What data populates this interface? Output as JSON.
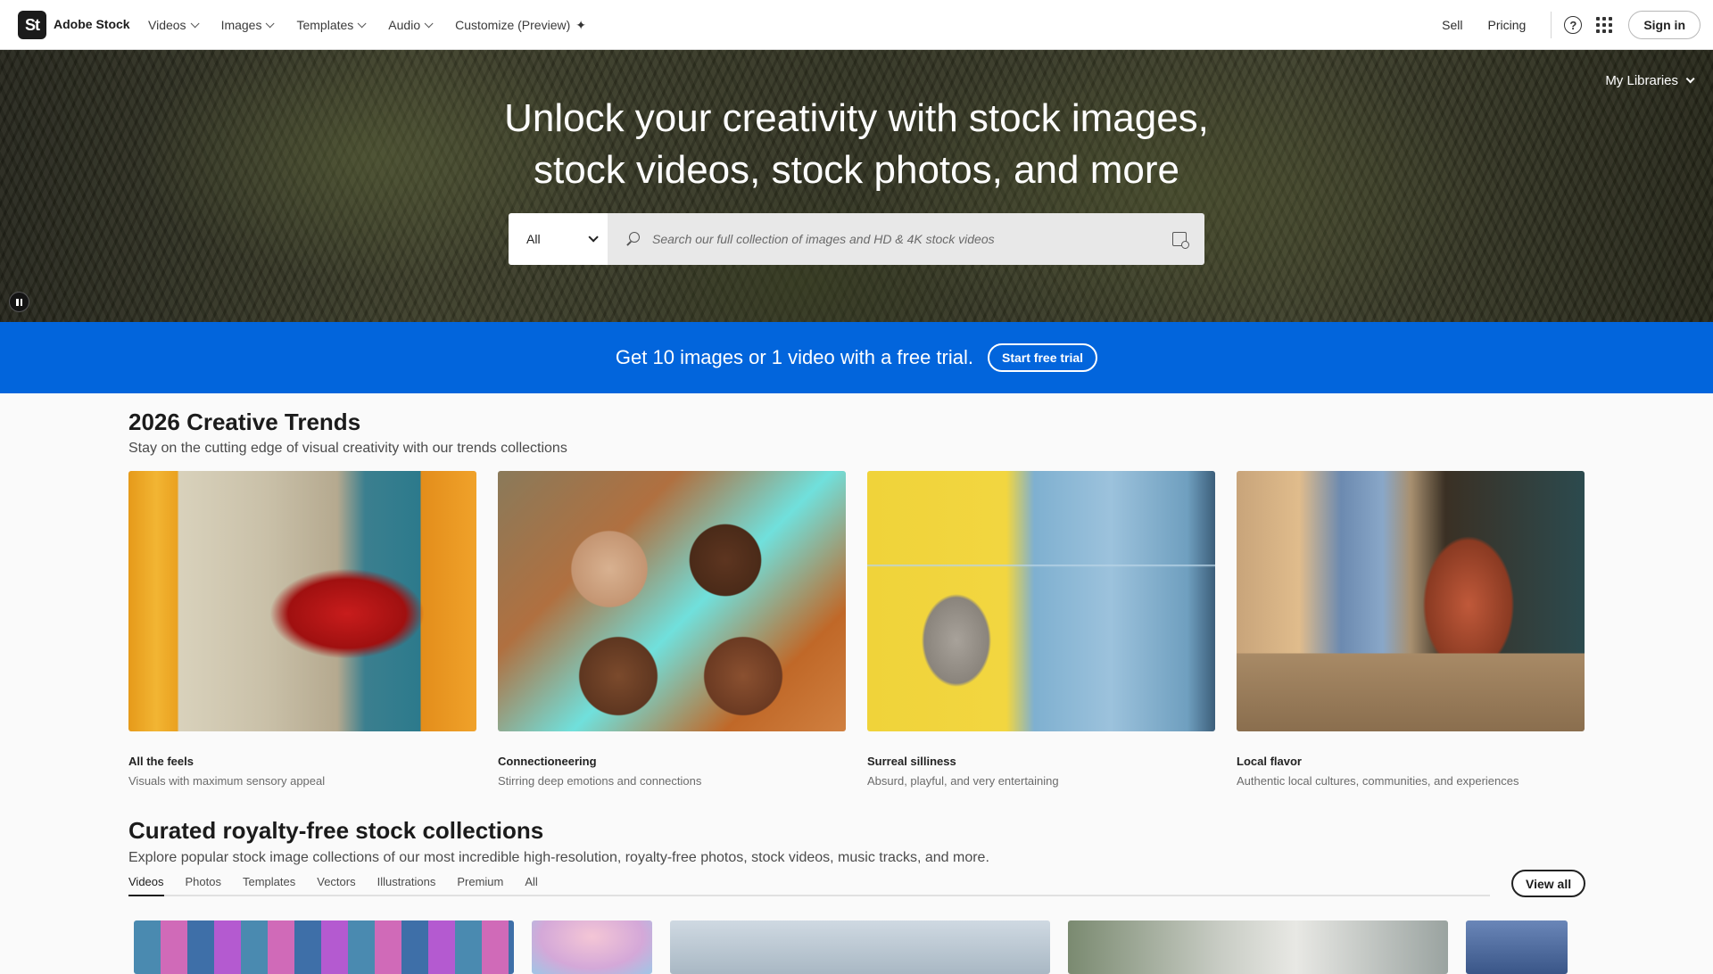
{
  "nav": {
    "logo": "St",
    "brand": "Adobe Stock",
    "menu": [
      {
        "label": "Videos"
      },
      {
        "label": "Images"
      },
      {
        "label": "Templates"
      },
      {
        "label": "Audio"
      },
      {
        "label": "Customize (Preview)"
      }
    ],
    "sell": "Sell",
    "pricing": "Pricing",
    "help": "?",
    "signin": "Sign in"
  },
  "hero": {
    "title_line1": "Unlock your creativity with stock images,",
    "title_line2": "stock videos, stock photos, and more",
    "libraries": "My Libraries",
    "search": {
      "category": "All",
      "placeholder": "Search our full collection of images and HD & 4K stock videos"
    }
  },
  "promo": {
    "text": "Get 10 images or 1 video with a free trial.",
    "button": "Start free trial"
  },
  "trends": {
    "title": "2026 Creative Trends",
    "subtitle": "Stay on the cutting edge of visual creativity with our trends collections",
    "items": [
      {
        "title": "All the feels",
        "desc": "Visuals with maximum sensory appeal"
      },
      {
        "title": "Connectioneering",
        "desc": "Stirring deep emotions and connections"
      },
      {
        "title": "Surreal silliness",
        "desc": "Absurd, playful, and very entertaining"
      },
      {
        "title": "Local flavor",
        "desc": "Authentic local cultures, communities, and experiences"
      }
    ]
  },
  "curated": {
    "title": "Curated royalty-free stock collections",
    "subtitle": "Explore popular stock image collections of our most incredible high-resolution, royalty-free photos, stock videos, music tracks, and more.",
    "tabs": [
      "Videos",
      "Photos",
      "Templates",
      "Vectors",
      "Illustrations",
      "Premium",
      "All"
    ],
    "active_tab": "Videos",
    "view_all": "View all"
  },
  "colors": {
    "promo_blue": "#0265dc",
    "nav_bg": "#ffffff",
    "page_bg": "#fafafa"
  }
}
